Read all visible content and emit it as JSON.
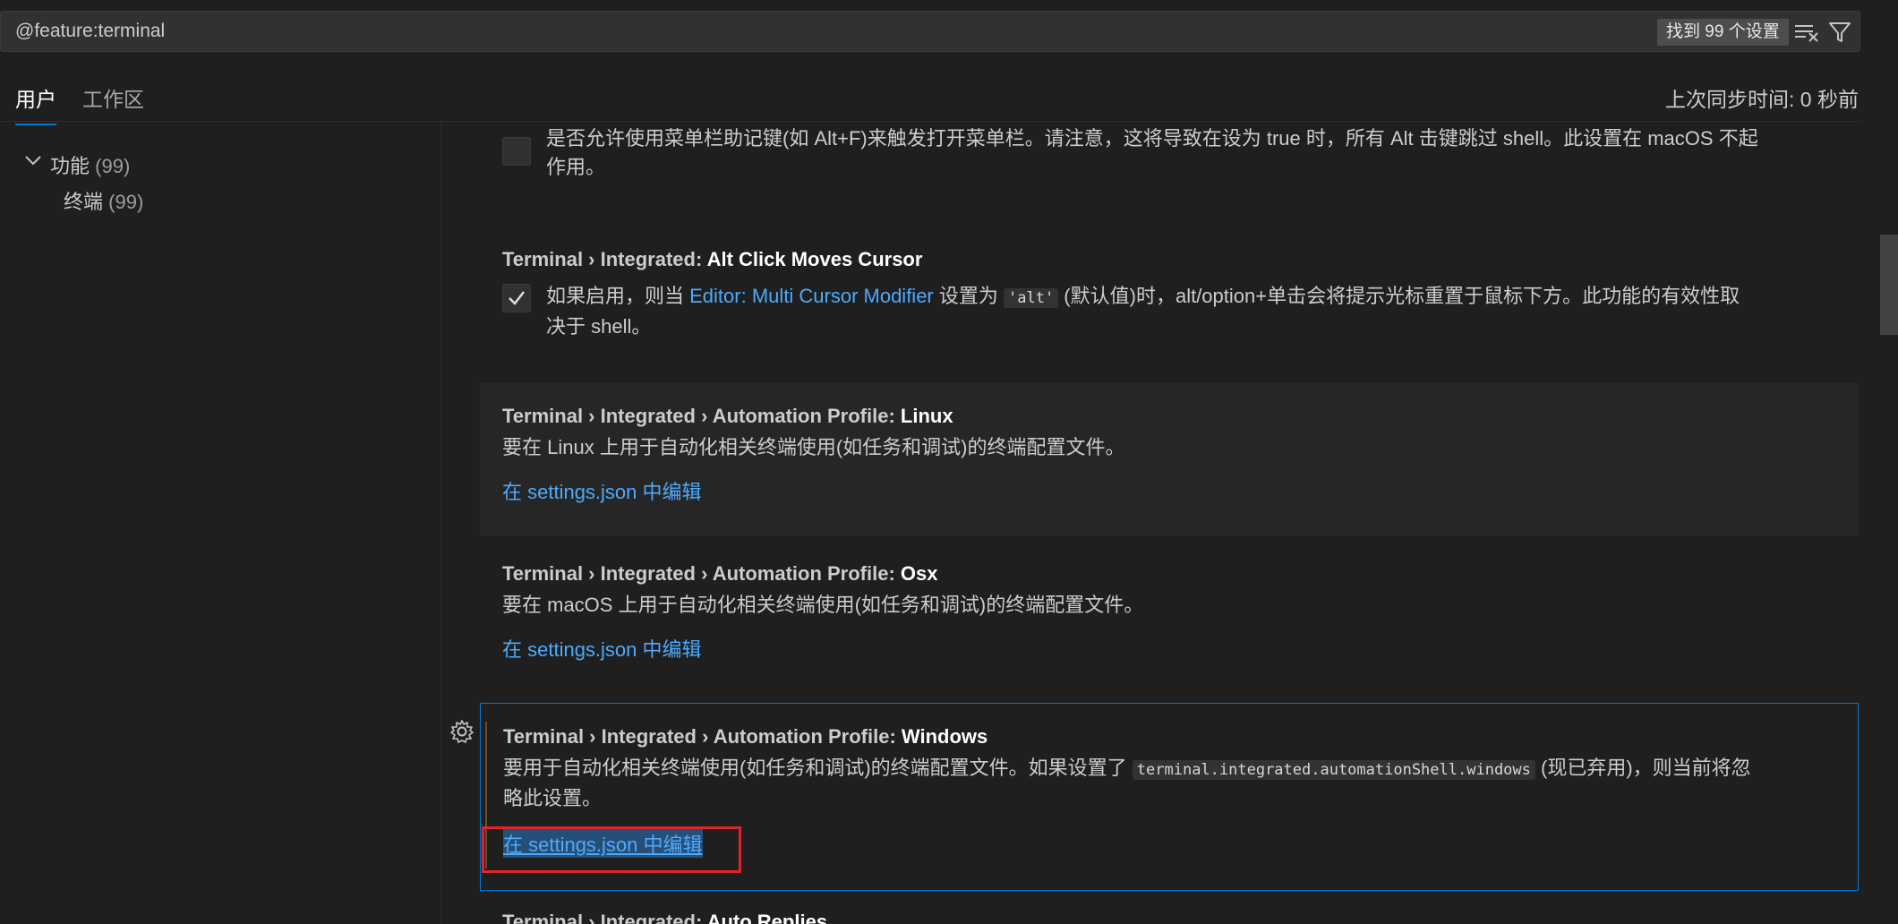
{
  "search": {
    "value": "@feature:terminal",
    "results_label": "找到 99 个设置",
    "clear_icon": "clear-filter-icon",
    "filter_icon": "filter-icon"
  },
  "tabs": {
    "user": "用户",
    "workspace": "工作区",
    "sync_status": "上次同步时间: 0 秒前"
  },
  "toc": {
    "features_label": "功能",
    "features_count": "(99)",
    "terminal_label": "终端",
    "terminal_count": "(99)"
  },
  "settings": {
    "partial_top_desc_line1": "是否允许使用菜单栏助记键(如 Alt+F)来触发打开菜单栏。请注意，这将导致在设为 true 时，所有 Alt 击键跳过 shell。此设置在 macOS 不起",
    "partial_top_desc_line2": "作用。",
    "alt_click": {
      "category": "Terminal › Integrated: ",
      "key": "Alt Click Moves Cursor",
      "desc_before": "如果启用，则当 ",
      "desc_link": "Editor: Multi Cursor Modifier",
      "desc_mid": " 设置为 ",
      "desc_code": "'alt'",
      "desc_after_line1": " (默认值)时，alt/option+单击会将提示光标重置于鼠标下方。此功能的有效性取",
      "desc_line2": "决于 shell。",
      "checked": true
    },
    "profile_linux": {
      "category": "Terminal › Integrated › Automation Profile: ",
      "key": "Linux",
      "desc": "要在 Linux 上用于自动化相关终端使用(如任务和调试)的终端配置文件。",
      "edit_link": "在 settings.json 中编辑"
    },
    "profile_osx": {
      "category": "Terminal › Integrated › Automation Profile: ",
      "key": "Osx",
      "desc": "要在 macOS 上用于自动化相关终端使用(如任务和调试)的终端配置文件。",
      "edit_link": "在 settings.json 中编辑"
    },
    "profile_windows": {
      "category": "Terminal › Integrated › Automation Profile: ",
      "key": "Windows",
      "desc_before": "要用于自动化相关终端使用(如任务和调试)的终端配置文件。如果设置了 ",
      "desc_code": "terminal.integrated.automationShell.windows",
      "desc_after_line1": " (现已弃用)，则当前将忽",
      "desc_line2": "略此设置。",
      "edit_link": "在 settings.json 中编辑"
    },
    "auto_replies": {
      "category": "Terminal › Integrated: ",
      "key": "Auto Replies"
    }
  }
}
